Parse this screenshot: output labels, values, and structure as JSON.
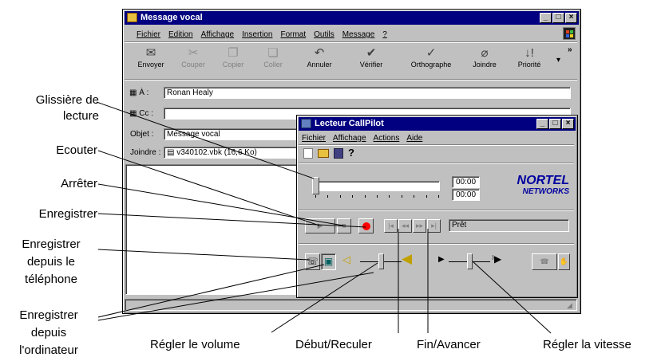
{
  "message_window": {
    "title": "Message vocal",
    "menu": [
      "Fichier",
      "Edition",
      "Affichage",
      "Insertion",
      "Format",
      "Outils",
      "Message",
      "?"
    ],
    "toolbar": [
      {
        "label": "Envoyer",
        "icon": "send-icon",
        "glyph": "✉",
        "enabled": true
      },
      {
        "label": "Couper",
        "icon": "scissors-icon",
        "glyph": "✂",
        "enabled": false
      },
      {
        "label": "Copier",
        "icon": "copy-icon",
        "glyph": "❐",
        "enabled": false
      },
      {
        "label": "Coller",
        "icon": "paste-icon",
        "glyph": "📋",
        "enabled": false
      },
      {
        "label": "Annuler",
        "icon": "undo-icon",
        "glyph": "↶",
        "enabled": true
      },
      {
        "label": "Vérifier",
        "icon": "check-names-icon",
        "glyph": "✔",
        "enabled": true
      },
      {
        "label": "Orthographe",
        "icon": "spelling-icon",
        "glyph": "✓",
        "enabled": true
      },
      {
        "label": "Joindre",
        "icon": "paperclip-icon",
        "glyph": "⌀",
        "enabled": true
      },
      {
        "label": "Priorité",
        "icon": "priority-icon",
        "glyph": "↓!",
        "enabled": true
      }
    ],
    "overflow": "»",
    "to_label": "À :",
    "to_value": "Ronan Healy",
    "cc_label": "Cc :",
    "cc_value": "",
    "subject_label": "Objet :",
    "subject_value": "Message vocal",
    "attach_label": "Joindre :",
    "attach_value": "v340102.vbk (16,6 Ko)"
  },
  "player_window": {
    "title": "Lecteur CallPilot",
    "menu": [
      "Fichier",
      "Affichage",
      "Actions",
      "Aide"
    ],
    "time_top": "00:00",
    "time_bottom": "00:00",
    "status": "Prêt",
    "brand_line1": "NORTEL",
    "brand_line2": "NETWORKS",
    "playback_position": 0,
    "volume_level": 0.5,
    "speed_level": 0.5
  },
  "callouts": {
    "glissiere": "Glissière de lecture",
    "ecouter": "Ecouter",
    "arreter": "Arrêter",
    "enregistrer": "Enregistrer",
    "enregistrer_telephone": "Enregistrer depuis le téléphone",
    "enregistrer_ordinateur": "Enregistrer depuis l'ordinateur",
    "volume": "Régler le volume",
    "debut": "Début/Reculer",
    "fin": "Fin/Avancer",
    "vitesse": "Régler la vitesse"
  },
  "colors": {
    "titlebar": "#000080",
    "window_face": "#c0c0c0",
    "record_red": "#ff0000",
    "nortel_blue": "#0000a0"
  }
}
